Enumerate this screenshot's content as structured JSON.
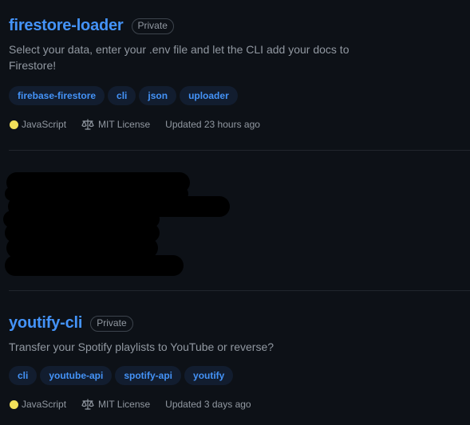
{
  "repos": [
    {
      "name": "firestore-loader",
      "visibility": "Private",
      "description": "Select your data, enter your .env file and let the CLI add your docs to Firestore!",
      "topics": [
        "firebase-firestore",
        "cli",
        "json",
        "uploader"
      ],
      "language": "JavaScript",
      "language_color": "#f1e05a",
      "license": "MIT License",
      "updated": "Updated 23 hours ago"
    },
    {
      "name": "youtify-cli",
      "visibility": "Private",
      "description": "Transfer your Spotify playlists to YouTube or reverse?",
      "topics": [
        "cli",
        "youtube-api",
        "spotify-api",
        "youtify"
      ],
      "language": "JavaScript",
      "language_color": "#f1e05a",
      "license": "MIT License",
      "updated": "Updated 3 days ago"
    }
  ],
  "colors": {
    "background": "#0d1117",
    "link": "#4493f8",
    "topic_bg": "#121d2f",
    "muted_text": "#9198a1",
    "divider": "#21262d"
  }
}
